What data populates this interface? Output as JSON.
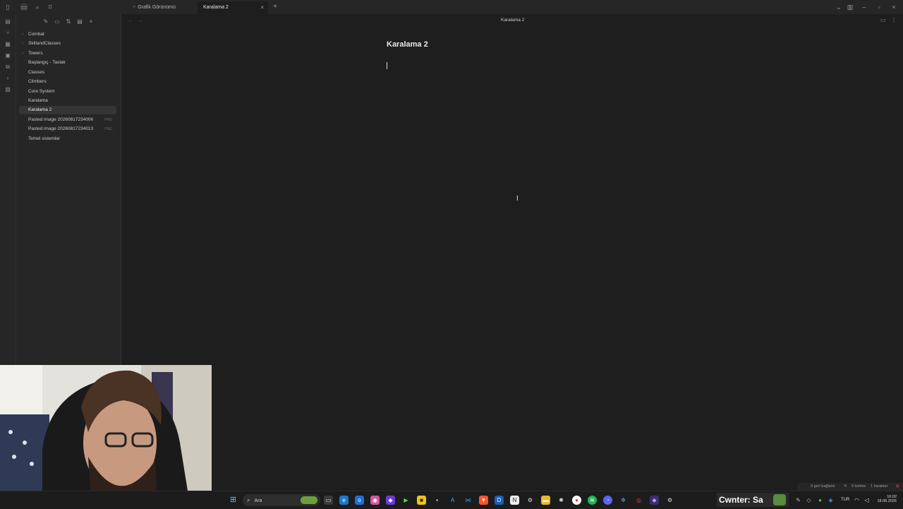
{
  "window": {
    "tabs": [
      {
        "label": "Grafik Görünümü",
        "active": false
      },
      {
        "label": "Karalama 2",
        "active": true
      }
    ],
    "new_tab_symbol": "+",
    "tab_close_symbol": "×"
  },
  "sidebar": {
    "actions": [
      "new-note-icon",
      "new-folder-icon",
      "sort-icon",
      "collapse-all-icon",
      "close-icon"
    ],
    "items": [
      {
        "label": "Combat",
        "type": "folder"
      },
      {
        "label": "SkillandClasses",
        "type": "folder"
      },
      {
        "label": "Towers",
        "type": "folder"
      },
      {
        "label": "Başlangıç - Taslak",
        "type": "file"
      },
      {
        "label": "Classes",
        "type": "file"
      },
      {
        "label": "Climbers",
        "type": "file"
      },
      {
        "label": "Core System",
        "type": "file"
      },
      {
        "label": "Karalama",
        "type": "file"
      },
      {
        "label": "Karalama 2",
        "type": "file",
        "active": true
      },
      {
        "label": "Pasted image 20260817234006",
        "type": "file",
        "ext": "PNG"
      },
      {
        "label": "Pasted image 20260817234013",
        "type": "file",
        "ext": "PNG"
      },
      {
        "label": "Temel sistemler",
        "type": "file"
      }
    ]
  },
  "editor": {
    "header_title": "Karalama 2",
    "note_title": "Karalama 2",
    "body": ""
  },
  "statusbar": {
    "backlinks": "0 geri bağlantı",
    "words": "0 kelime",
    "chars": "1 karakter"
  },
  "taskbar": {
    "search_label": "Ara",
    "overlay_text": "Cwnter: Sa",
    "language": "TUR",
    "time": "16:02",
    "date": "18.08.2026"
  },
  "colors": {
    "background": "#1e1e1e",
    "sidebar": "#262626",
    "accent": "#7f6df2"
  }
}
